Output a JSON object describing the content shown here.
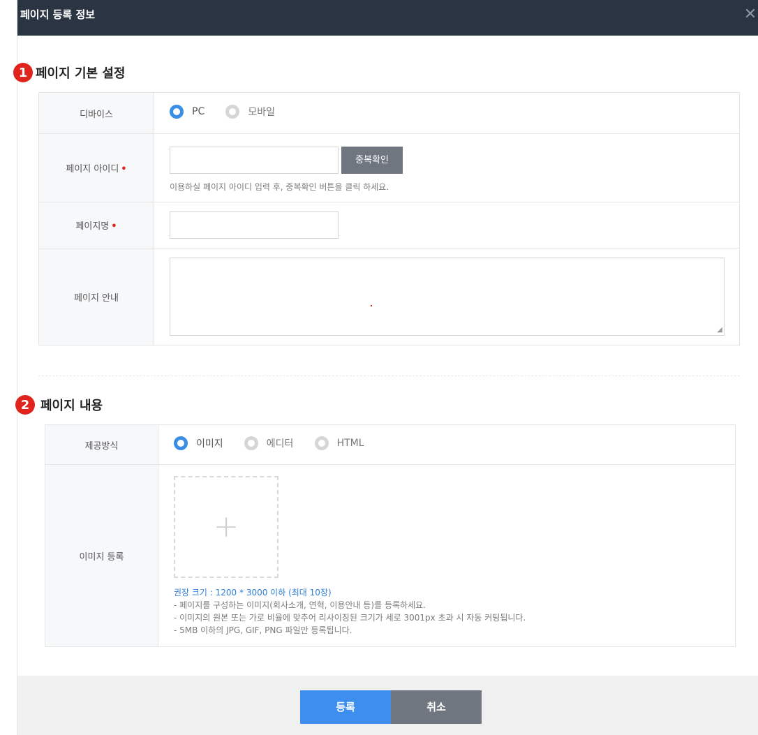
{
  "window": {
    "title": "페이지 등록 정보",
    "close_icon": "close-icon"
  },
  "section1": {
    "number": "1",
    "title": "페이지 기본 설정",
    "device": {
      "label": "디바이스",
      "options": [
        {
          "label": "PC",
          "selected": true
        },
        {
          "label": "모바일",
          "selected": false
        }
      ]
    },
    "page_id": {
      "label": "페이지 아이디",
      "required_mark": "•",
      "value": "",
      "check_button": "중복확인",
      "hint": "이용하실 페이지 아이디 입력 후, 중복확인 버튼을 클릭 하세요."
    },
    "page_name": {
      "label": "페이지명",
      "required_mark": "•",
      "value": ""
    },
    "page_guide": {
      "label": "페이지 안내",
      "value": ""
    }
  },
  "section2": {
    "number": "2",
    "title": "페이지 내용",
    "method": {
      "label": "제공방식",
      "options": [
        {
          "label": "이미지",
          "selected": true
        },
        {
          "label": "에디터",
          "selected": false
        },
        {
          "label": "HTML",
          "selected": false
        }
      ]
    },
    "image": {
      "label": "이미지 등록",
      "guide_title": "권장 크기 : 1200 * 3000 이하 (최대 10장)",
      "guide_lines": [
        "- 페이지를 구성하는 이미지(회사소개, 연혁, 이용안내 등)를 등록하세요.",
        "- 이미지의 원본 또는 가로 비율에 맞추어 리사이징된 크기가 세로 3001px 초과 시 자동 커팅됩니다.",
        "- 5MB 이하의 JPG, GIF, PNG 파일만 등록됩니다."
      ]
    }
  },
  "footer": {
    "submit": "등록",
    "cancel": "취소"
  },
  "colors": {
    "header": "#2b3442",
    "accent": "#3e8ef0",
    "required": "#e0231c",
    "guide": "#2f80d6"
  }
}
